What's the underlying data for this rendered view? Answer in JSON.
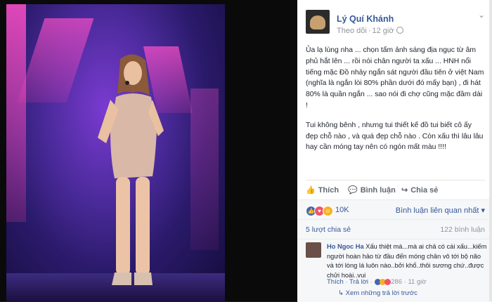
{
  "post": {
    "author": "Lý Quí Khánh",
    "follow": "Theo dõi",
    "time": "12 giờ",
    "paragraphs": [
      "Ủa lạ lùng nha ... chọn tấm ảnh sáng địa ngục từ âm phủ hắt lên ... rồi nói chân người ta xấu ... HNH nổi tiếng mặc Đồ nhảy ngắn sát người đầu tiên ở việt Nam (nghĩa là ngắn lòi 80% phần dưới đó mấy bạn) , đi hát 80% là quần ngắn ... sao nói đi chợ cũng mặc đầm dài !",
      "Tui không bênh , nhưng tui thiết kế đồ tui biết cô ấy đẹp chỗ nào , và quá đẹp chỗ nào . Còn xấu thì lâu lâu hay cần móng tay nên có ngón mất màu !!!!"
    ]
  },
  "actions": {
    "like": "Thích",
    "comment": "Bình luận",
    "share": "Chia sẻ"
  },
  "reactions": {
    "count": "10K",
    "sort": "Bình luận liên quan nhất"
  },
  "stats": {
    "shares": "5 lượt chia sẻ",
    "comments": "122 bình luận"
  },
  "comment": {
    "name": "Ho Ngoc Ha",
    "text": " Xấu thiệt má...mà ai chả có cái xấu...kiếm người hoàn hảo từ đầu đến móng chân vô tới bộ não và tới lòng lá luôn nào..bởi khổ..thôi sương chứ..được chửi hoài..vui",
    "like": "Thích",
    "reply": "Trả lời",
    "reaction_count": "286",
    "time": "11 giờ",
    "more_replies": "Xem những trả lời trước"
  },
  "colors": {
    "link": "#365899",
    "muted": "#90949c",
    "like": "#4267b2",
    "love": "#f25268",
    "haha": "#f7b125"
  }
}
